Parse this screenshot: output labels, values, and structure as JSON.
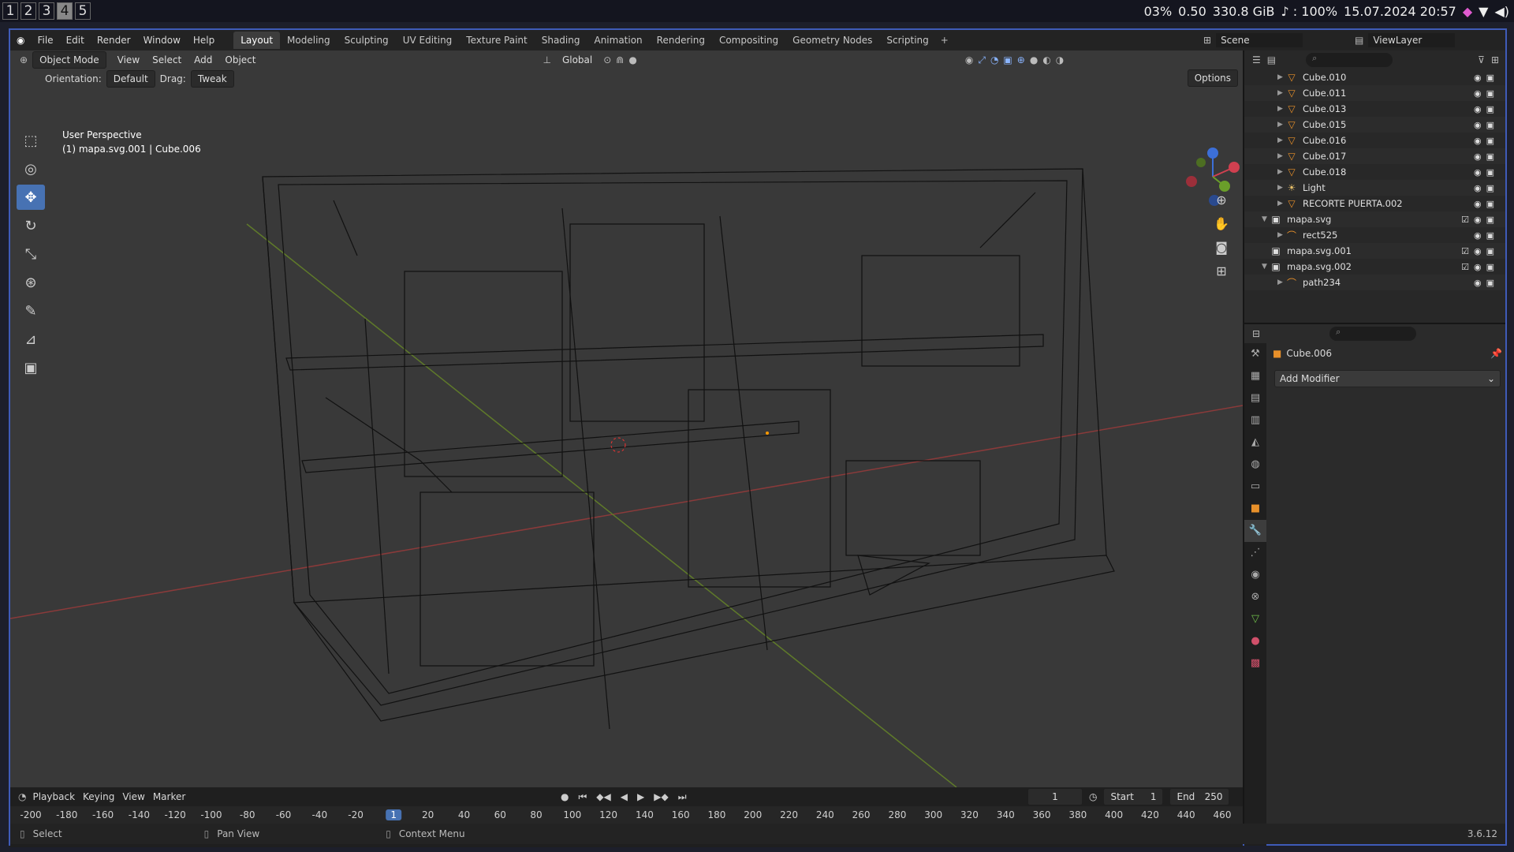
{
  "system": {
    "workspaces": [
      "1",
      "2",
      "3",
      "4",
      "5"
    ],
    "active_workspace": "4",
    "cpu": "03%",
    "load": "0.50",
    "disk": "330.8 GiB",
    "volume": "♪ : 100%",
    "datetime": "15.07.2024 20:57"
  },
  "menus": [
    "File",
    "Edit",
    "Render",
    "Window",
    "Help"
  ],
  "tabs": [
    "Layout",
    "Modeling",
    "Sculpting",
    "UV Editing",
    "Texture Paint",
    "Shading",
    "Animation",
    "Rendering",
    "Compositing",
    "Geometry Nodes",
    "Scripting"
  ],
  "active_tab": "Layout",
  "scene": "Scene",
  "view_layer": "ViewLayer",
  "viewport": {
    "mode": "Object Mode",
    "menus": [
      "View",
      "Select",
      "Add",
      "Object"
    ],
    "transform": "Global",
    "orientation_label": "Orientation:",
    "orientation_value": "Default",
    "drag_label": "Drag:",
    "drag_value": "Tweak",
    "options": "Options",
    "perspective": "User Perspective",
    "object_info": "(1) mapa.svg.001 | Cube.006"
  },
  "outliner": {
    "items": [
      {
        "name": "Cube.010",
        "icon": "mesh"
      },
      {
        "name": "Cube.011",
        "icon": "mesh"
      },
      {
        "name": "Cube.013",
        "icon": "mesh"
      },
      {
        "name": "Cube.015",
        "icon": "mesh"
      },
      {
        "name": "Cube.016",
        "icon": "mesh"
      },
      {
        "name": "Cube.017",
        "icon": "mesh"
      },
      {
        "name": "Cube.018",
        "icon": "mesh"
      },
      {
        "name": "Light",
        "icon": "light"
      },
      {
        "name": "RECORTE PUERTA.002",
        "icon": "mesh"
      },
      {
        "name": "mapa.svg",
        "icon": "collection"
      },
      {
        "name": "rect525",
        "icon": "curve"
      },
      {
        "name": "mapa.svg.001",
        "icon": "collection"
      },
      {
        "name": "mapa.svg.002",
        "icon": "collection"
      },
      {
        "name": "path234",
        "icon": "curve"
      }
    ]
  },
  "properties": {
    "object": "Cube.006",
    "add_modifier": "Add Modifier"
  },
  "timeline": {
    "menus": [
      "Playback",
      "Keying",
      "View",
      "Marker"
    ],
    "current_frame": "1",
    "start_label": "Start",
    "start": "1",
    "end_label": "End",
    "end": "250",
    "ticks": [
      "-200",
      "-180",
      "-160",
      "-140",
      "-120",
      "-100",
      "-80",
      "-60",
      "-40",
      "-20",
      "1",
      "20",
      "40",
      "60",
      "80",
      "100",
      "120",
      "140",
      "160",
      "180",
      "200",
      "220",
      "240",
      "260",
      "280",
      "300",
      "320",
      "340",
      "360",
      "380",
      "400",
      "420",
      "440",
      "460"
    ]
  },
  "status": {
    "select": "Select",
    "pan": "Pan View",
    "context": "Context Menu",
    "version": "3.6.12"
  }
}
